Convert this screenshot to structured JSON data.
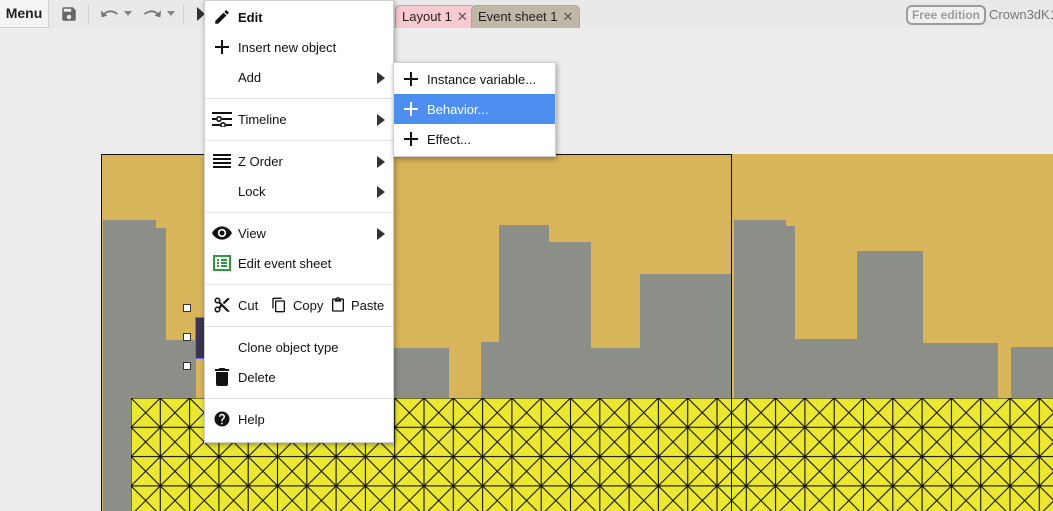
{
  "toolbar": {
    "menu_label": "Menu",
    "tabs": [
      {
        "label": "Layout 1",
        "bg": "#f8c9d0"
      },
      {
        "label": "Event sheet 1",
        "bg": "#bfb8a6"
      }
    ],
    "edition_label": "Free edition",
    "username": "Crown3dK1"
  },
  "context_menu": {
    "items": {
      "edit": "Edit",
      "insert_new_object": "Insert new object",
      "add": "Add",
      "timeline": "Timeline",
      "z_order": "Z Order",
      "lock": "Lock",
      "view": "View",
      "edit_event_sheet": "Edit event sheet",
      "cut": "Cut",
      "copy": "Copy",
      "paste": "Paste",
      "clone_object_type": "Clone object type",
      "delete": "Delete",
      "help": "Help"
    }
  },
  "submenu": {
    "items": [
      "Instance variable...",
      "Behavior...",
      "Effect..."
    ],
    "highlighted": "Behavior..."
  },
  "colors": {
    "sky": "#d8b45a",
    "buildings": "#8c8f88",
    "ground": "#ece832",
    "highlight": "#4d8ff1"
  },
  "icons": [
    "save-icon",
    "undo-icon",
    "redo-icon",
    "pencil-icon",
    "plus-icon",
    "timeline-icon",
    "zorder-icon",
    "eye-icon",
    "event-sheet-icon",
    "scissors-icon",
    "copy-icon",
    "paste-icon",
    "trash-icon",
    "help-icon"
  ]
}
